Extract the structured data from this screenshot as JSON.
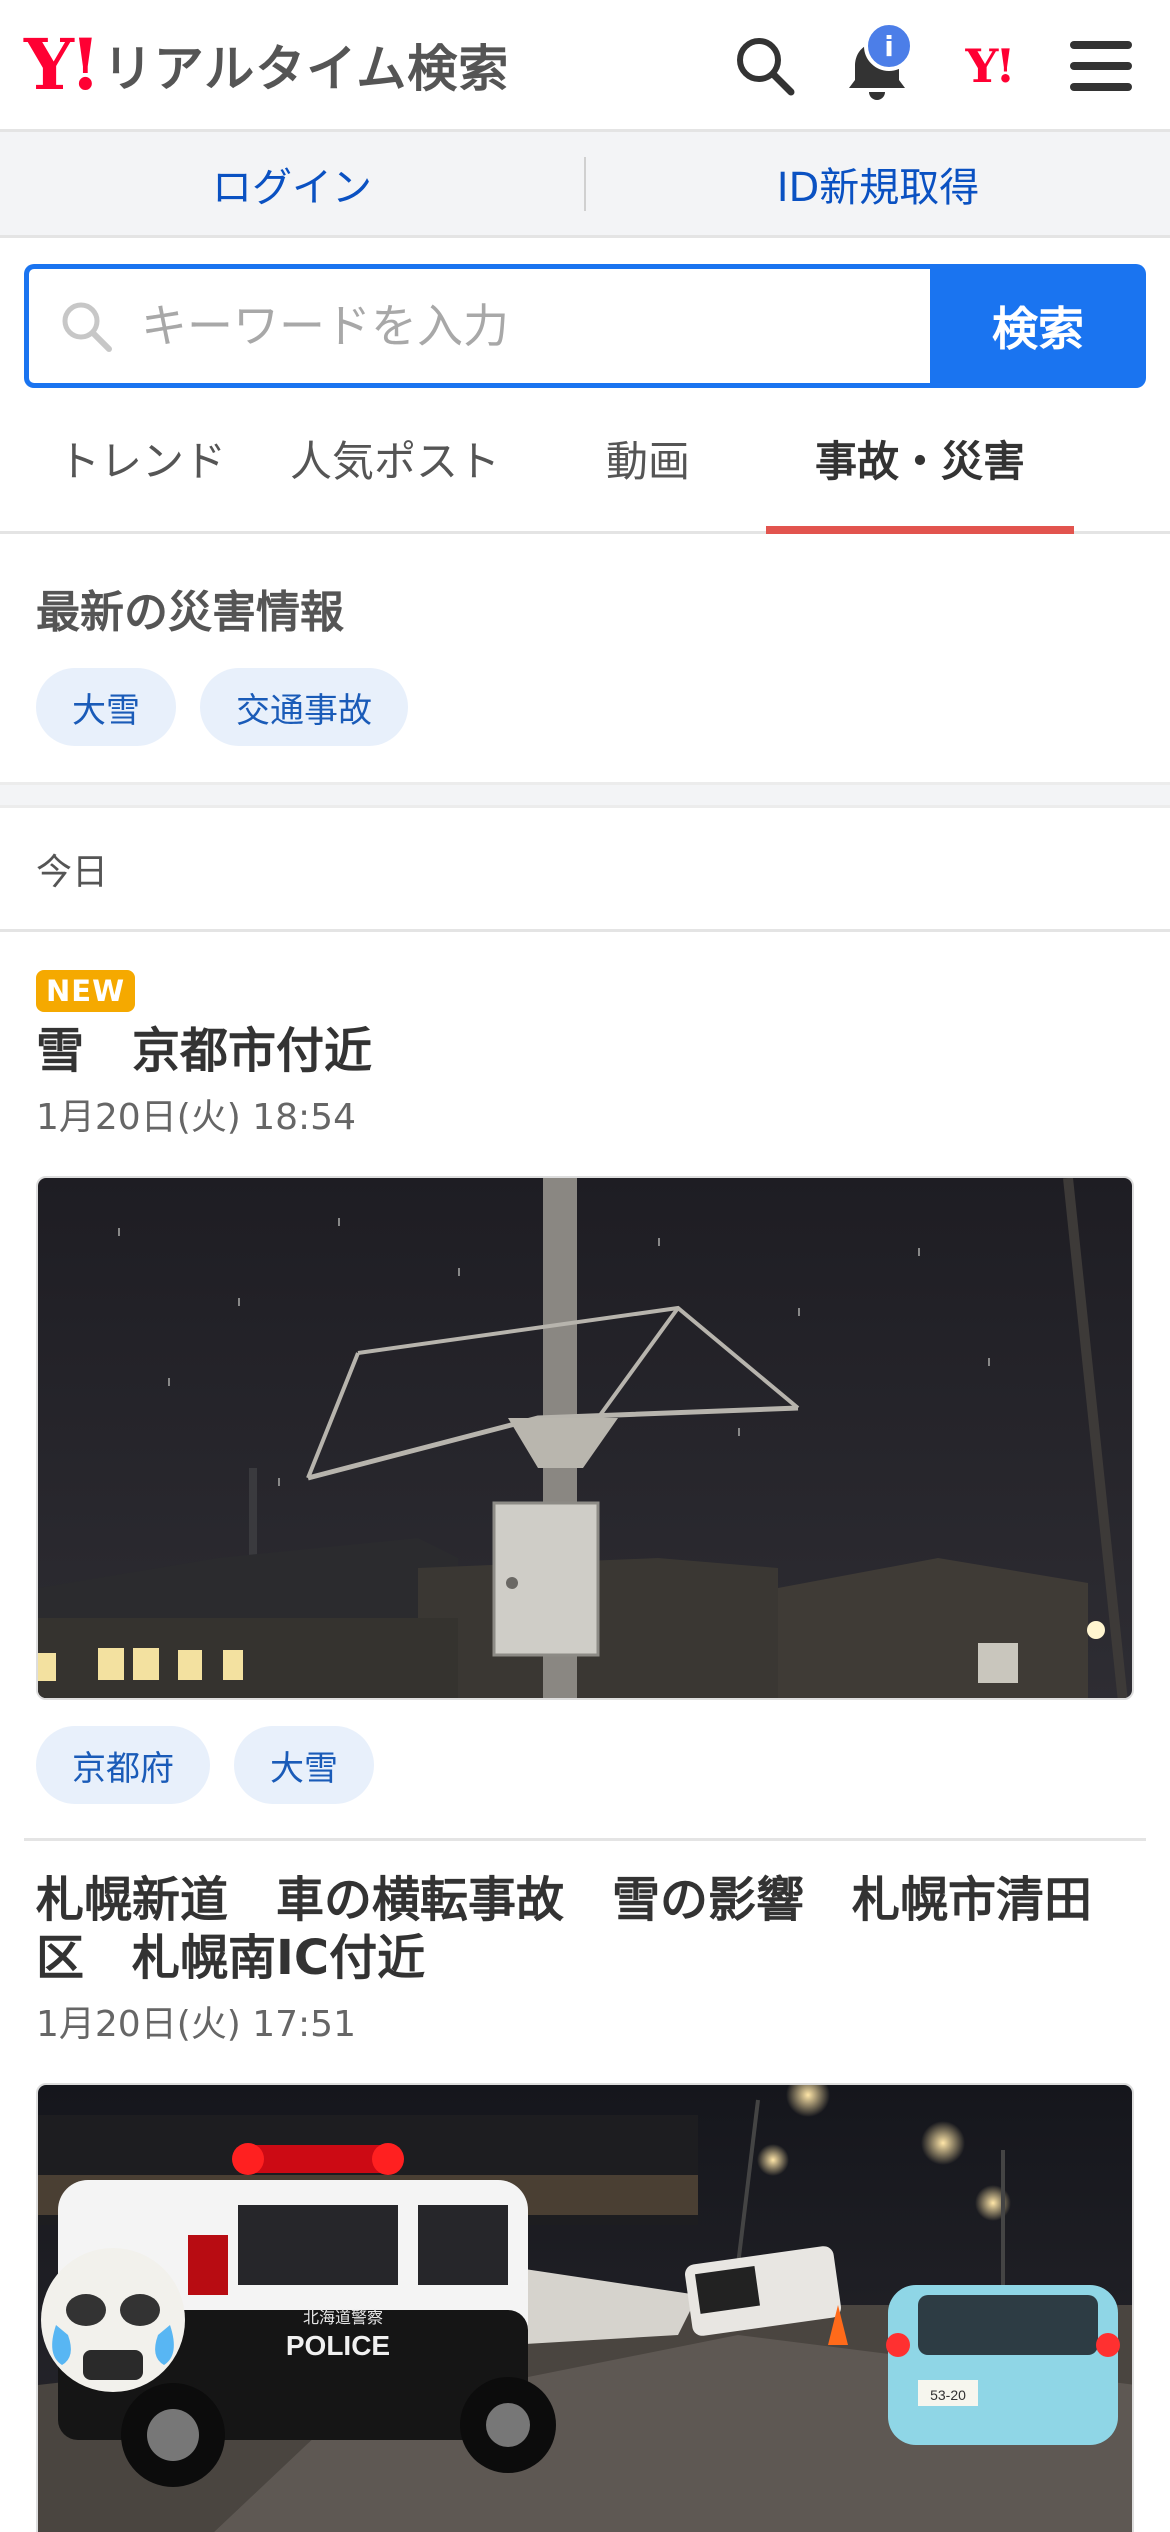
{
  "header": {
    "logo_mark": "Y!",
    "logo_text": "リアルタイム検索",
    "notification_badge": "i",
    "small_logo": "Y!",
    "icons": [
      "search-icon",
      "bell-icon",
      "yahoo-logo-icon",
      "hamburger-menu-icon"
    ]
  },
  "login_bar": {
    "login": "ログイン",
    "signup": "ID新規取得"
  },
  "search": {
    "placeholder": "キーワードを入力",
    "button": "検索"
  },
  "tabs": [
    {
      "label": "トレンド",
      "active": false
    },
    {
      "label": "人気ポスト",
      "active": false
    },
    {
      "label": "動画",
      "active": false
    },
    {
      "label": "事故・災害",
      "active": true
    }
  ],
  "disaster": {
    "title": "最新の災害情報",
    "chips": [
      "大雪",
      "交通事故"
    ]
  },
  "date_header": "今日",
  "articles": [
    {
      "badge": "NEW",
      "title": "雪　京都市付近",
      "time": "1月20日(火) 18:54",
      "chips": [
        "京都府",
        "大雪"
      ]
    },
    {
      "badge": "",
      "title": "札幌新道　車の横転事故　雪の影響　札幌市清田区　札幌南IC付近",
      "time": "1月20日(火) 17:51",
      "police_text": "POLICE",
      "car_text": "北海道警察",
      "plate": "53-20"
    }
  ],
  "colors": {
    "brand": "#ff0033",
    "link": "#0a51c2",
    "search_blue": "#1a74f0",
    "tab_underline": "#e2544e",
    "new_badge": "#f5a900",
    "chip_bg": "#e8f0fb"
  }
}
